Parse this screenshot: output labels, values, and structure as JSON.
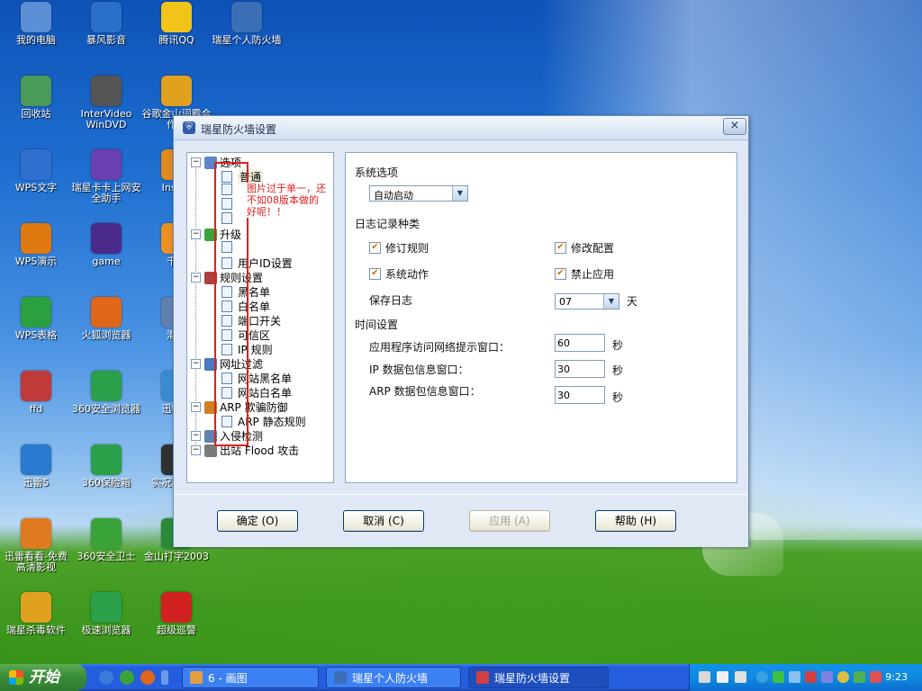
{
  "desktop": {
    "icons": [
      {
        "label": "我的电脑",
        "icon": "computer-icon",
        "color": "#5a8fd6"
      },
      {
        "label": "暴风影音",
        "icon": "storm-player-icon",
        "color": "#2a6fc9"
      },
      {
        "label": "腾讯QQ",
        "icon": "qq-penguin-icon",
        "color": "#f0c419"
      },
      {
        "label": "瑞星个人防火墙",
        "icon": "firewall-icon",
        "color": "#3b6fb8"
      },
      {
        "label": "回收站",
        "icon": "recycle-bin-icon",
        "color": "#4a9a5a"
      },
      {
        "label": "InterVideo WinDVD",
        "icon": "dvd-icon",
        "color": "#555555"
      },
      {
        "label": "谷歌金山词霸合作版",
        "icon": "dictionary-icon",
        "color": "#e0a020"
      },
      {
        "label": "WPS文字",
        "icon": "wps-writer-icon",
        "color": "#2f6fd0"
      },
      {
        "label": "瑞星卡卡上网安全助手",
        "icon": "kaka-assistant-icon",
        "color": "#6a3fb0"
      },
      {
        "label": "Insani",
        "icon": "app-icon",
        "color": "#e08a20"
      },
      {
        "label": "WPS演示",
        "icon": "wps-presentation-icon",
        "color": "#e07a10"
      },
      {
        "label": "game",
        "icon": "game-icon",
        "color": "#4a2a8a"
      },
      {
        "label": "千千",
        "icon": "ttplayer-icon",
        "color": "#f09020"
      },
      {
        "label": "WPS表格",
        "icon": "wps-spreadsheet-icon",
        "color": "#2aa040"
      },
      {
        "label": "火狐浏览器",
        "icon": "firefox-icon",
        "color": "#e0661a"
      },
      {
        "label": "潜意",
        "icon": "app-icon",
        "color": "#6080b0"
      },
      {
        "label": "ffd",
        "icon": "fish-icon",
        "color": "#c03a3a"
      },
      {
        "label": "360安全浏览器",
        "icon": "360-browser-icon",
        "color": "#2aa04a"
      },
      {
        "label": "迅雷软",
        "icon": "thunder-soft-icon",
        "color": "#3a8ad0"
      },
      {
        "label": "迅雷5",
        "icon": "thunder-icon",
        "color": "#2a7ad0"
      },
      {
        "label": "360保险箱",
        "icon": "360-safe-box-icon",
        "color": "#2aa04a"
      },
      {
        "label": "实况足体中",
        "icon": "pes-icon",
        "color": "#303030"
      },
      {
        "label": "迅雷看看-免费高清影视",
        "icon": "xunlei-kankan-icon",
        "color": "#e07a20"
      },
      {
        "label": "360安全卫士",
        "icon": "360-guard-icon",
        "color": "#3aa43a"
      },
      {
        "label": "金山打字2003",
        "icon": "typing-icon",
        "color": "#2a8a3a"
      },
      {
        "label": "瑞星杀毒软件",
        "icon": "rising-antivirus-icon",
        "color": "#e0a020"
      },
      {
        "label": "极速浏览器",
        "icon": "fast-browser-icon",
        "color": "#2aa04a"
      },
      {
        "label": "超级巡警",
        "icon": "police-siren-icon",
        "color": "#d02020"
      }
    ]
  },
  "dialog": {
    "title": "瑞星防火墙设置",
    "close_glyph": "×",
    "tree": {
      "items": [
        {
          "label": "选项",
          "kind": "group",
          "icon": "options-icon"
        },
        {
          "label": "普通",
          "kind": "leaf",
          "selected": true
        },
        {
          "label": "",
          "kind": "leaf"
        },
        {
          "label": "",
          "kind": "leaf"
        },
        {
          "label": "",
          "kind": "leaf"
        },
        {
          "label": "升级",
          "kind": "group",
          "icon": "upgrade-icon"
        },
        {
          "label": "",
          "kind": "leaf"
        },
        {
          "label": "用户ID设置",
          "kind": "leaf"
        },
        {
          "label": "规则设置",
          "kind": "group",
          "icon": "rules-icon"
        },
        {
          "label": "黑名单",
          "kind": "leaf"
        },
        {
          "label": "白名单",
          "kind": "leaf"
        },
        {
          "label": "端口开关",
          "kind": "leaf"
        },
        {
          "label": "可信区",
          "kind": "leaf"
        },
        {
          "label": "IP 规则",
          "kind": "leaf"
        },
        {
          "label": "网址过滤",
          "kind": "group",
          "icon": "url-filter-icon"
        },
        {
          "label": "网站黑名单",
          "kind": "leaf"
        },
        {
          "label": "网站白名单",
          "kind": "leaf"
        },
        {
          "label": "ARP 欺骗防御",
          "kind": "group",
          "icon": "arp-icon"
        },
        {
          "label": "ARP 静态规则",
          "kind": "leaf"
        },
        {
          "label": "入侵检测",
          "kind": "group",
          "icon": "intrusion-icon"
        },
        {
          "label": "出站 Flood 攻击",
          "kind": "group",
          "icon": "flood-icon"
        }
      ]
    },
    "annotation": "图片过于单一，还不如08版本做的好呢！！",
    "content": {
      "system_options_label": "系统选项",
      "startup_value": "自动启动",
      "log_types_label": "日志记录种类",
      "checks": [
        {
          "label": "修订规则",
          "checked": true
        },
        {
          "label": "修改配置",
          "checked": true
        },
        {
          "label": "系统动作",
          "checked": true
        },
        {
          "label": "禁止应用",
          "checked": true
        }
      ],
      "save_log_label": "保存日志",
      "save_log_value": "07",
      "days_unit": "天",
      "time_settings_label": "时间设置",
      "app_prompt_label": "应用程序访问网络提示窗口：",
      "app_prompt_value": "60",
      "ip_packet_label": "IP 数据包信息窗口：",
      "ip_packet_value": "30",
      "arp_packet_label": "ARP 数据包信息窗口：",
      "arp_packet_value": "30",
      "seconds_unit": "秒"
    },
    "buttons": {
      "ok": "确定 (O)",
      "cancel": "取消 (C)",
      "apply": "应用 (A)",
      "help": "帮助 (H)"
    }
  },
  "taskbar": {
    "start_label": "开始",
    "tasks": [
      {
        "label": "6 - 画图",
        "icon": "paint-icon",
        "active": false
      },
      {
        "label": "瑞星个人防火墙",
        "icon": "firewall-icon",
        "active": false
      },
      {
        "label": "瑞星防火墙设置",
        "icon": "firewall-settings-icon",
        "active": true
      }
    ],
    "clock": "9:23"
  }
}
